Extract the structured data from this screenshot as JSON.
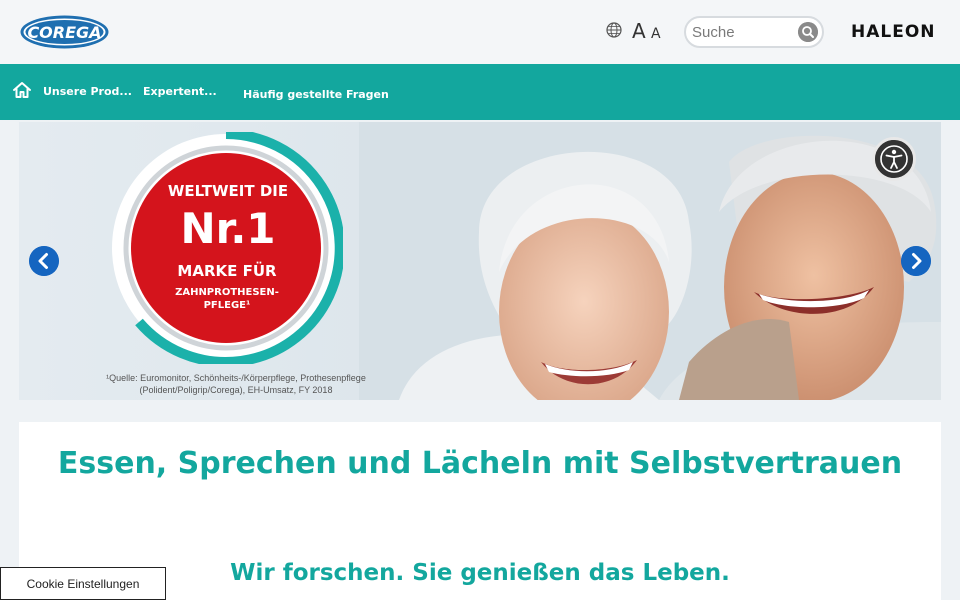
{
  "header": {
    "logo_text": "COREGA",
    "font_size_large": "A",
    "font_size_small": "A",
    "search_placeholder": "Suche",
    "brand": "HALEON"
  },
  "nav": {
    "items": [
      {
        "label": "Unsere Prod..."
      },
      {
        "label": "Expertent..."
      },
      {
        "label": "Häufig gestellte Fragen"
      }
    ]
  },
  "hero": {
    "badge_line1": "WELTWEIT DIE",
    "badge_line2": "Nr.1",
    "badge_line3": "MARKE FÜR",
    "badge_line4": "ZAHNPROTHESEN-\nPFLEGE¹",
    "source_note": "¹Quelle: Euromonitor, Schönheits-/Körperpflege, Prothesenpflege (Polident/Poligrip/Corega), EH-Umsatz, FY 2018"
  },
  "content": {
    "headline": "Essen, Sprechen und Lächeln mit Selbstvertrauen",
    "subline": "Wir forschen. Sie genießen das Leben."
  },
  "cookie": {
    "label": "Cookie Einstellungen"
  },
  "icons": [
    "globe-icon",
    "search-icon",
    "home-icon",
    "arrow-left-icon",
    "arrow-right-icon",
    "accessibility-icon"
  ],
  "colors": {
    "primary_teal": "#13a79e",
    "nav_bg": "#13a79e",
    "carousel_arrow": "#1565c0",
    "badge_red": "#d4141c"
  }
}
